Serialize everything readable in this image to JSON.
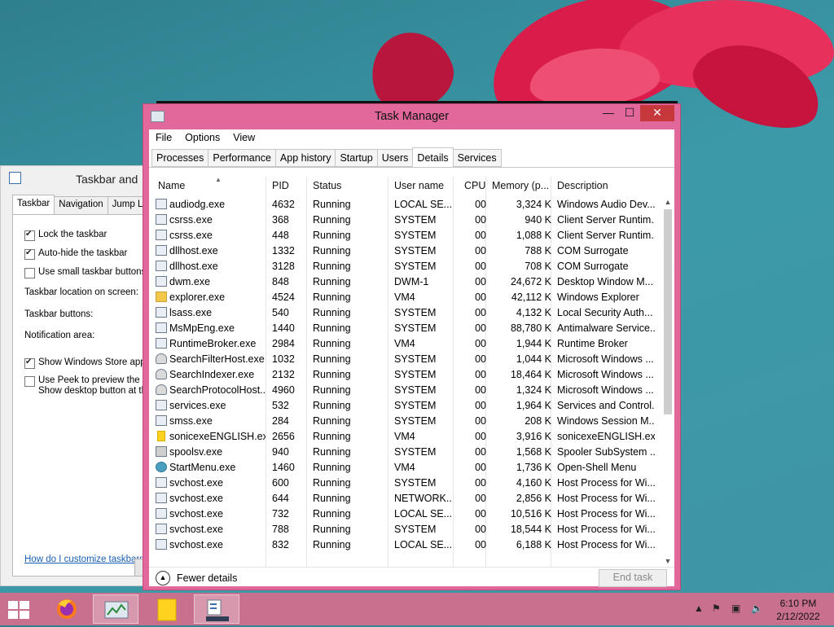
{
  "taskbar_properties": {
    "title": "Taskbar and",
    "tabs": [
      "Taskbar",
      "Navigation",
      "Jump Lis"
    ],
    "options": [
      {
        "label": "Lock the taskbar",
        "checked": true
      },
      {
        "label": "Auto-hide the taskbar",
        "checked": true
      },
      {
        "label": "Use small taskbar buttons",
        "checked": false
      }
    ],
    "labels": {
      "location": "Taskbar location on screen:",
      "buttons": "Taskbar buttons:",
      "notification": "Notification area:"
    },
    "store_apps": {
      "label": "Show Windows Store apps",
      "checked": true
    },
    "peek": {
      "line1": "Use Peek to preview the de",
      "line2": "Show desktop button at the",
      "checked": false
    },
    "help_link": "How do I customize taskbars?"
  },
  "task_manager": {
    "title": "Task Manager",
    "window_buttons": {
      "minimize": "—",
      "maximize": "☐",
      "close": "✕"
    },
    "menu": [
      "File",
      "Options",
      "View"
    ],
    "tabs": [
      "Processes",
      "Performance",
      "App history",
      "Startup",
      "Users",
      "Details",
      "Services"
    ],
    "active_tab": "Details",
    "columns": {
      "name": "Name",
      "pid": "PID",
      "status": "Status",
      "user": "User name",
      "cpu": "CPU",
      "memory": "Memory (p...",
      "description": "Description"
    },
    "rows": [
      {
        "icon": "exe-icon",
        "name": "audiodg.exe",
        "pid": "4632",
        "status": "Running",
        "user": "LOCAL SE...",
        "cpu": "00",
        "memory": "3,324 K",
        "description": "Windows Audio Dev..."
      },
      {
        "icon": "exe-icon",
        "name": "csrss.exe",
        "pid": "368",
        "status": "Running",
        "user": "SYSTEM",
        "cpu": "00",
        "memory": "940 K",
        "description": "Client Server Runtim..."
      },
      {
        "icon": "exe-icon",
        "name": "csrss.exe",
        "pid": "448",
        "status": "Running",
        "user": "SYSTEM",
        "cpu": "00",
        "memory": "1,088 K",
        "description": "Client Server Runtim..."
      },
      {
        "icon": "exe-icon",
        "name": "dllhost.exe",
        "pid": "1332",
        "status": "Running",
        "user": "SYSTEM",
        "cpu": "00",
        "memory": "788 K",
        "description": "COM Surrogate"
      },
      {
        "icon": "exe-icon",
        "name": "dllhost.exe",
        "pid": "3128",
        "status": "Running",
        "user": "SYSTEM",
        "cpu": "00",
        "memory": "708 K",
        "description": "COM Surrogate"
      },
      {
        "icon": "exe-icon",
        "name": "dwm.exe",
        "pid": "848",
        "status": "Running",
        "user": "DWM-1",
        "cpu": "00",
        "memory": "24,672 K",
        "description": "Desktop Window M..."
      },
      {
        "icon": "folder-icon",
        "name": "explorer.exe",
        "pid": "4524",
        "status": "Running",
        "user": "VM4",
        "cpu": "00",
        "memory": "42,112 K",
        "description": "Windows Explorer"
      },
      {
        "icon": "exe-icon",
        "name": "lsass.exe",
        "pid": "540",
        "status": "Running",
        "user": "SYSTEM",
        "cpu": "00",
        "memory": "4,132 K",
        "description": "Local Security Auth..."
      },
      {
        "icon": "exe-icon",
        "name": "MsMpEng.exe",
        "pid": "1440",
        "status": "Running",
        "user": "SYSTEM",
        "cpu": "00",
        "memory": "88,780 K",
        "description": "Antimalware Service..."
      },
      {
        "icon": "exe-icon",
        "name": "RuntimeBroker.exe",
        "pid": "2984",
        "status": "Running",
        "user": "VM4",
        "cpu": "00",
        "memory": "1,944 K",
        "description": "Runtime Broker"
      },
      {
        "icon": "person-icon",
        "name": "SearchFilterHost.exe",
        "pid": "1032",
        "status": "Running",
        "user": "SYSTEM",
        "cpu": "00",
        "memory": "1,044 K",
        "description": "Microsoft Windows ..."
      },
      {
        "icon": "person-icon",
        "name": "SearchIndexer.exe",
        "pid": "2132",
        "status": "Running",
        "user": "SYSTEM",
        "cpu": "00",
        "memory": "18,464 K",
        "description": "Microsoft Windows ..."
      },
      {
        "icon": "person-icon",
        "name": "SearchProtocolHost....",
        "pid": "4960",
        "status": "Running",
        "user": "SYSTEM",
        "cpu": "00",
        "memory": "1,324 K",
        "description": "Microsoft Windows ..."
      },
      {
        "icon": "exe-icon",
        "name": "services.exe",
        "pid": "532",
        "status": "Running",
        "user": "SYSTEM",
        "cpu": "00",
        "memory": "1,964 K",
        "description": "Services and Control..."
      },
      {
        "icon": "exe-icon",
        "name": "smss.exe",
        "pid": "284",
        "status": "Running",
        "user": "SYSTEM",
        "cpu": "00",
        "memory": "208 K",
        "description": "Windows Session M..."
      },
      {
        "icon": "yellow-file-icon",
        "name": "sonicexeENGLISH.exe",
        "pid": "2656",
        "status": "Running",
        "user": "VM4",
        "cpu": "00",
        "memory": "3,916 K",
        "description": "sonicexeENGLISH.exe"
      },
      {
        "icon": "printer-icon",
        "name": "spoolsv.exe",
        "pid": "940",
        "status": "Running",
        "user": "SYSTEM",
        "cpu": "00",
        "memory": "1,568 K",
        "description": "Spooler SubSystem ..."
      },
      {
        "icon": "globe-icon",
        "name": "StartMenu.exe",
        "pid": "1460",
        "status": "Running",
        "user": "VM4",
        "cpu": "00",
        "memory": "1,736 K",
        "description": "Open-Shell Menu"
      },
      {
        "icon": "exe-icon",
        "name": "svchost.exe",
        "pid": "600",
        "status": "Running",
        "user": "SYSTEM",
        "cpu": "00",
        "memory": "4,160 K",
        "description": "Host Process for Wi..."
      },
      {
        "icon": "exe-icon",
        "name": "svchost.exe",
        "pid": "644",
        "status": "Running",
        "user": "NETWORK...",
        "cpu": "00",
        "memory": "2,856 K",
        "description": "Host Process for Wi..."
      },
      {
        "icon": "exe-icon",
        "name": "svchost.exe",
        "pid": "732",
        "status": "Running",
        "user": "LOCAL SE...",
        "cpu": "00",
        "memory": "10,516 K",
        "description": "Host Process for Wi..."
      },
      {
        "icon": "exe-icon",
        "name": "svchost.exe",
        "pid": "788",
        "status": "Running",
        "user": "SYSTEM",
        "cpu": "00",
        "memory": "18,544 K",
        "description": "Host Process for Wi..."
      },
      {
        "icon": "exe-icon",
        "name": "svchost.exe",
        "pid": "832",
        "status": "Running",
        "user": "LOCAL SE...",
        "cpu": "00",
        "memory": "6,188 K",
        "description": "Host Process for Wi..."
      }
    ],
    "fewer_details": "Fewer details",
    "end_task": "End task"
  },
  "taskbar": {
    "apps": [
      "start-button",
      "firefox",
      "task-manager",
      "file-explorer",
      "taskbar-properties"
    ],
    "tray_icons": [
      "show-hidden-icons",
      "action-center-flag",
      "network-icon",
      "volume-icon"
    ],
    "time": "6:10 PM",
    "date": "2/12/2022"
  },
  "colors": {
    "window_frame": "#e2689b",
    "taskbar": "#c8708e",
    "close_button": "#c7383d",
    "desktop": "#3c9aa8"
  }
}
